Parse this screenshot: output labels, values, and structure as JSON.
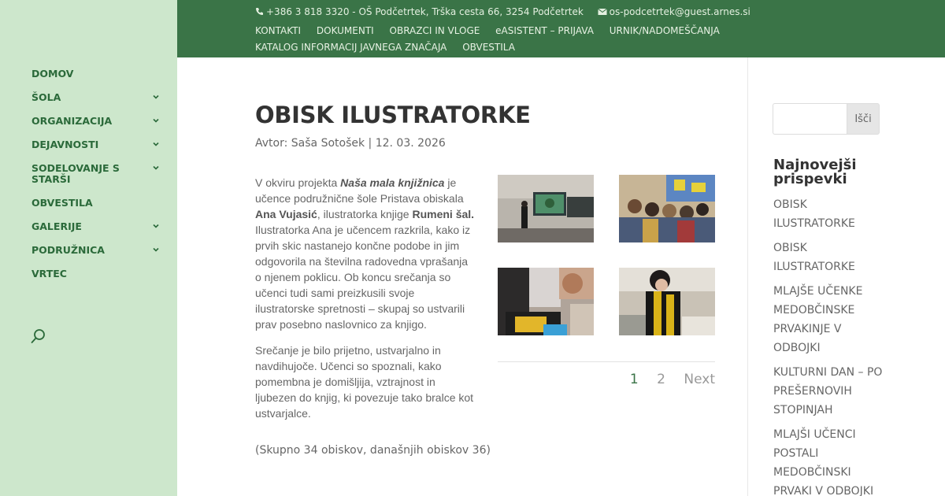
{
  "header": {
    "phone": "+386 3 818 3320 - OŠ Podčetrtek, Trška cesta 66, 3254 Podčetrtek",
    "email": "os-podcetrtek@guest.arnes.si",
    "menu": [
      "KONTAKTI",
      "DOKUMENTI",
      "OBRAZCI IN VLOGE",
      "eASISTENT – PRIJAVA",
      "URNIK/NADOMEŠČANJA",
      "KATALOG INFORMACIJ JAVNEGA ZNAČAJA",
      "OBVESTILA"
    ]
  },
  "sidebar": {
    "items": [
      {
        "label": "DOMOV"
      },
      {
        "label": "ŠOLA"
      },
      {
        "label": "ORGANIZACIJA"
      },
      {
        "label": "DEJAVNOSTI"
      },
      {
        "label": "SODELOVANJE S STARŠI"
      },
      {
        "label": "OBVESTILA"
      },
      {
        "label": "GALERIJE"
      },
      {
        "label": "PODRUŽNICA"
      },
      {
        "label": "VRTEC"
      }
    ]
  },
  "post": {
    "title": "OBISK ILUSTRATORKE",
    "meta": "Avtor: Saša Sotošek | 12. 03. 2026",
    "p1": {
      "a": "V okviru projekta ",
      "b": "Naša mala knjižnica",
      "c": " je učence podružnične šole Pristava obiskala ",
      "d": "Ana Vujasić",
      "e": ", ilustratorka knjige ",
      "f": "Rumeni šal.",
      "g": " Ilustratorka Ana je učencem razkrila, kako iz prvih skic nastanejo končne podobe in jim odgovorila na številna radovedna vprašanja o njenem poklicu. Ob koncu srečanja so učenci tudi sami preizkusili svoje ilustratorske spretnosti – skupaj so ustvarili prav posebno naslovnico za knjigo."
    },
    "p2": "Srečanje je bilo prijetno, ustvarjalno in navdihujoče. Učenci so spoznali, kako pomembna je domišljija, vztrajnost in ljubezen do knjig, ki povezuje tako bralce kot ustvarjalce.",
    "visits": "(Skupno 34 obiskov, današnjih obiskov 36)"
  },
  "pagination": {
    "pages": [
      "1",
      "2"
    ],
    "next": "Next"
  },
  "right": {
    "search_button": "Išči",
    "recent_title": "Najnovejši prispevki",
    "recent": [
      "OBISK ILUSTRATORKE",
      "OBISK ILUSTRATORKE",
      "MLAJŠE UČENKE MEDOBČINSKE PRVAKINJE V ODBOJKI",
      "KULTURNI DAN – PO PREŠERNOVIH STOPINJAH",
      "MLAJŠI UČENCI POSTALI MEDOBČINSKI PRVAKI V ODBOJKI"
    ]
  },
  "colors": {
    "topbar": "#3a7447",
    "sidebar": "#cde7cc",
    "nav_text": "#2b6a3a"
  },
  "icons": {
    "phone": "phone-icon",
    "email": "envelope-icon",
    "chevron": "chevron-down-icon",
    "search": "search-icon"
  }
}
